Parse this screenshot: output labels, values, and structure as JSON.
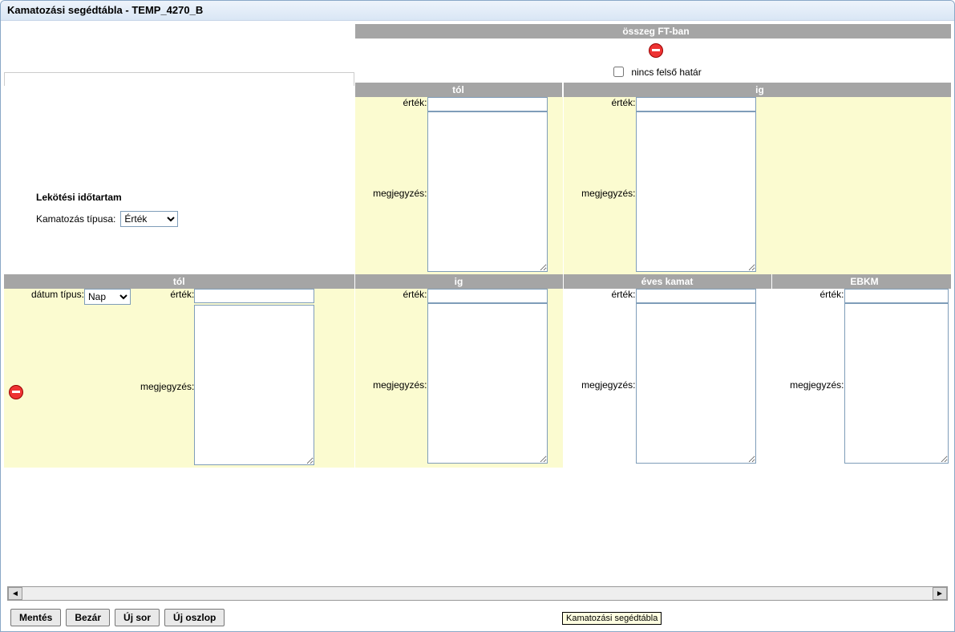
{
  "window_title": "Kamatozási segédtábla - TEMP_4270_B",
  "left": {
    "section_title": "Lekötési időtartam",
    "type_label": "Kamatozás típusa:",
    "type_value": "Érték"
  },
  "top_right": {
    "header": "összeg FT-ban",
    "no_upper_limit_label": "nincs felső határ",
    "no_upper_limit_checked": false,
    "tol_header": "tól",
    "ig_header": "ig",
    "value_label": "érték:",
    "note_label": "megjegyzés:",
    "tol_value": "",
    "tol_note": "",
    "ig_value": "",
    "ig_note": ""
  },
  "row_headers": {
    "tol": "tól",
    "ig": "ig",
    "eves_kamat": "éves kamat",
    "ebkm": "EBKM"
  },
  "row": {
    "date_type_label": "dátum típus:",
    "date_type_value": "Nap",
    "value_label": "érték:",
    "note_label": "megjegyzés:",
    "tol_value": "",
    "tol_note": "",
    "ig_value": "",
    "ig_note": "",
    "ek_value": "",
    "ek_note": "",
    "ebkm_value": "",
    "ebkm_note": ""
  },
  "buttons": {
    "save": "Mentés",
    "close": "Bezár",
    "new_row": "Új sor",
    "new_col": "Új oszlop"
  },
  "tooltip": "Kamatozási segédtábla"
}
